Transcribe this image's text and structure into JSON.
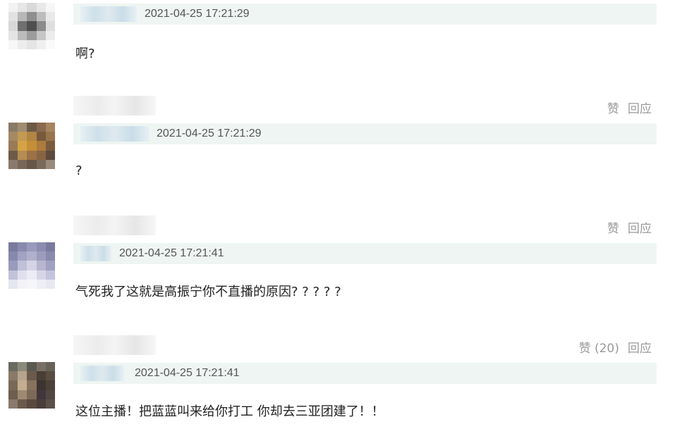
{
  "comments": [
    {
      "time": "2021-04-25 17:21:29",
      "text": "啊?",
      "like": "赞",
      "reply": "回应"
    },
    {
      "time": "2021-04-25 17:21:29",
      "text": "?",
      "like": "赞",
      "reply": "回应"
    },
    {
      "time": "2021-04-25 17:21:41",
      "text": "气死我了这就是高振宁你不直播的原因? ? ? ? ?",
      "like": "赞 (20)",
      "reply": "回应"
    },
    {
      "time": "2021-04-25 17:21:41",
      "text": "这位主播！把蓝蓝叫来给你打工 你却去三亚团建了！！"
    }
  ]
}
